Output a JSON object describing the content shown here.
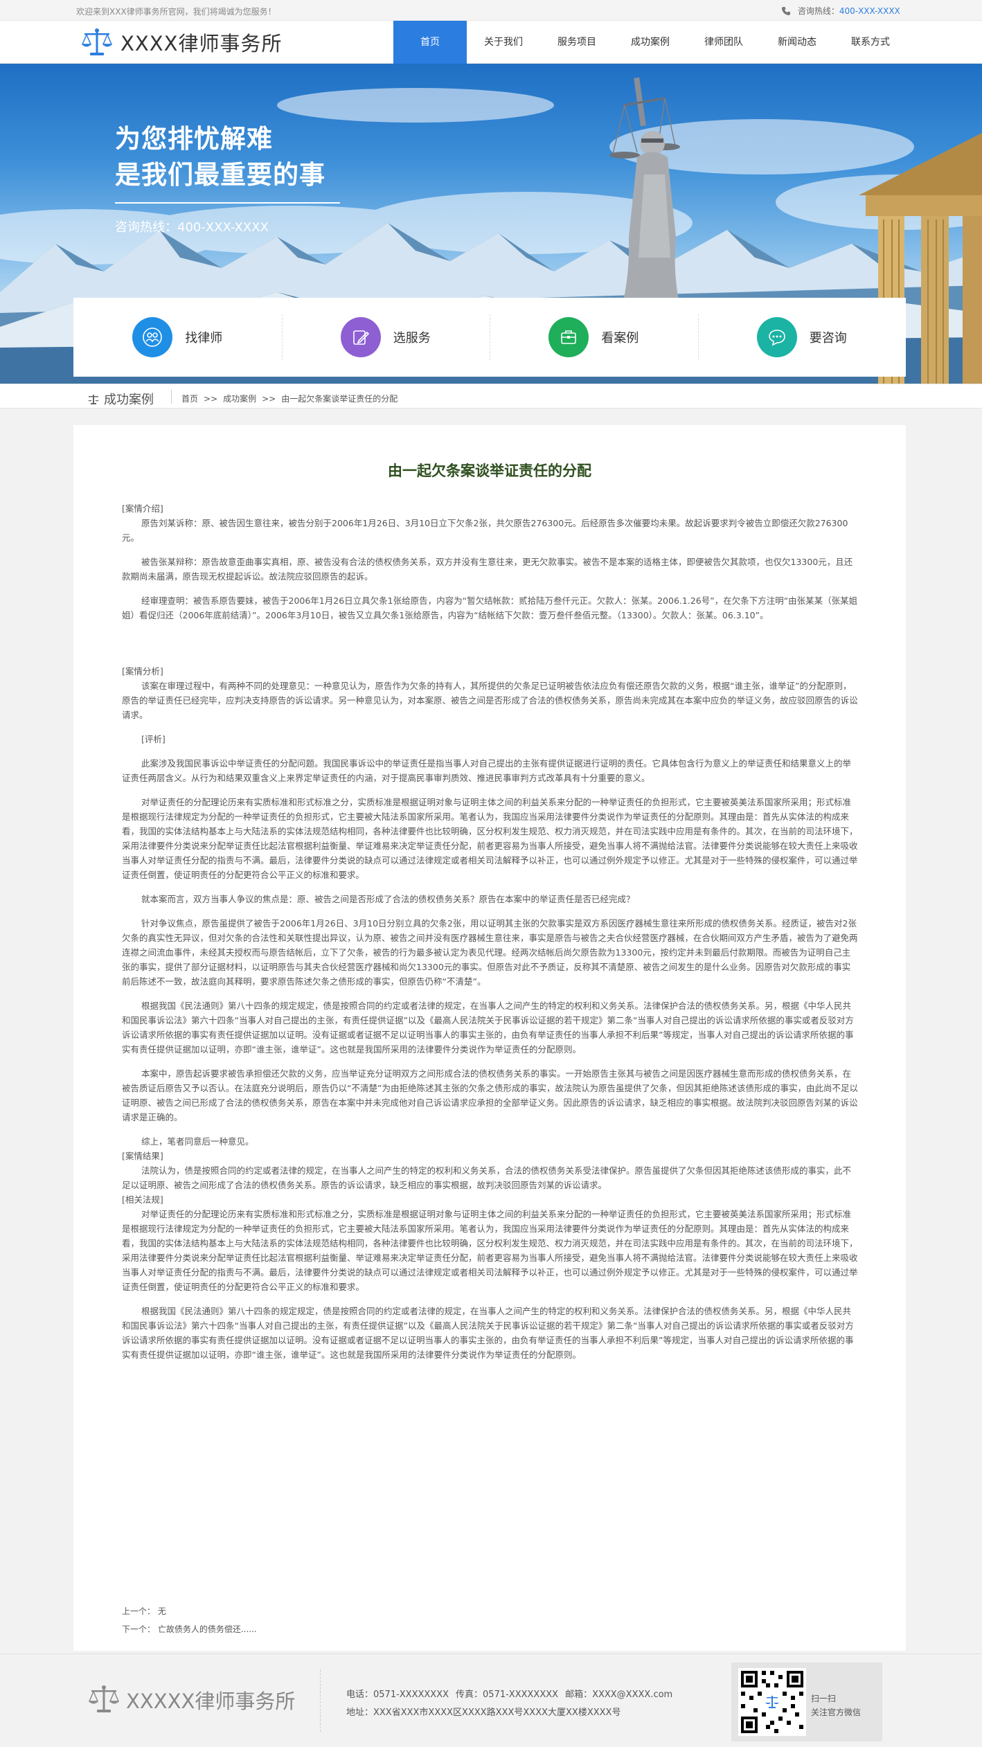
{
  "topbar": {
    "welcome": "欢迎来到XXX律师事务所官网，我们将竭诚为您服务！",
    "hotline_label": "咨询热线：",
    "hotline_number": "400-XXX-XXXX"
  },
  "header": {
    "logo_text": "XXXX律师事务所",
    "nav": [
      "首页",
      "关于我们",
      "服务项目",
      "成功案例",
      "律师团队",
      "新闻动态",
      "联系方式"
    ]
  },
  "banner": {
    "slogan_line1": "为您排忧解难",
    "slogan_line2": "是我们最重要的事",
    "hotline": "咨询热线：400-XXX-XXXX"
  },
  "services": [
    {
      "label": "找律师",
      "icon": "people-icon",
      "color": "#1f8fe6"
    },
    {
      "label": "选服务",
      "icon": "edit-icon",
      "color": "#8d5fd3"
    },
    {
      "label": "看案例",
      "icon": "briefcase-icon",
      "color": "#1fae5a"
    },
    {
      "label": "要咨询",
      "icon": "chat-icon",
      "color": "#1bb3a3"
    }
  ],
  "breadcrumb": {
    "section": "成功案例",
    "items": [
      "首页",
      ">>",
      "成功案例",
      ">>",
      "由一起欠条案谈举证责任的分配"
    ]
  },
  "article": {
    "title": "由一起欠条案谈举证责任的分配",
    "h_case": "[案情介绍]",
    "p1": "原告刘某诉称：原、被告因生意往来，被告分别于2006年1月26日、3月10日立下欠条2张，共欠原告276300元。后经原告多次催要均未果。故起诉要求判令被告立即偿还欠款276300元。",
    "p2": "被告张某辩称：原告故意歪曲事实真相，原、被告没有合法的债权债务关系，双方并没有生意往来，更无欠款事实。被告不是本案的适格主体，即便被告欠其款项，也仅欠13300元，且还款期尚未届满，原告现无权提起诉讼。故法院应驳回原告的起诉。",
    "p3": "经审理查明：被告系原告要妹，被告于2006年1月26日立具欠条1张给原告，内容为“暂欠结帐款：贰拾陆万叁仟元正。欠款人：张某。2006.1.26号”，在欠条下方注明“由张某某（张某姐姐）看促归还（2006年底前结清）”。2006年3月10日，被告又立具欠条1张给原告，内容为“结帐结下欠款：壹万叁仟叁佰元整。（13300）。欠款人：张某。06.3.10”。",
    "h_analysis": "[案情分析]",
    "p4": "该案在审理过程中，有两种不同的处理意见：一种意见认为，原告作为欠条的持有人，其所提供的欠条足已证明被告依法应负有偿还原告欠款的义务，根据“谁主张，谁举证”的分配原则，原告的举证责任已经完毕，应判决支持原告的诉讼请求。另一种意见认为，对本案原、被告之间是否形成了合法的债权债务关系，原告尚未完成其在本案中应负的举证义务，故应驳回原告的诉讼请求。",
    "h_comment": "[评析]",
    "p5": "此案涉及我国民事诉讼中举证责任的分配问题。我国民事诉讼中的举证责任是指当事人对自己提出的主张有提供证据进行证明的责任。它具体包含行为意义上的举证责任和结果意义上的举证责任两层含义。从行为和结果双重含义上来界定举证责任的内涵，对于提高民事审判质效、推进民事审判方式改革具有十分重要的意义。",
    "p6": "对举证责任的分配理论历来有实质标准和形式标准之分，实质标准是根据证明对象与证明主体之间的利益关系来分配的一种举证责任的负担形式，它主要被英美法系国家所采用；形式标准是根据现行法律规定为分配的一种举证责任的负担形式，它主要被大陆法系国家所采用。笔者认为，我国应当采用法律要件分类说作为举证责任的分配原则。其理由是：首先从实体法的构成来看，我国的实体法结构基本上与大陆法系的实体法规范结构相同，各种法律要件也比较明确，区分权利发生规范、权力消灭规范，并在司法实践中应用是有条件的。其次，在当前的司法环境下，采用法律要件分类说来分配举证责任比起法官根据利益衡量、举证难易来决定举证责任分配，前者更容易为当事人所接受，避免当事人将不满抛给法官。法律要件分类说能够在较大责任上来吸收当事人对举证责任分配的指责与不满。最后，法律要件分类说的缺点可以通过法律规定或者相关司法解释予以补正，也可以通过例外规定予以修正。尤其是对于一些特殊的侵权案件，可以通过举证责任倒置，使证明责任的分配更符合公平正义的标准和要求。",
    "p7": "就本案而言，双方当事人争议的焦点是：原、被告之间是否形成了合法的债权债务关系？原告在本案中的举证责任是否已经完成？",
    "p8": "针对争议焦点，原告虽提供了被告于2006年1月26日、3月10日分别立具的欠条2张，用以证明其主张的欠款事实是双方系因医疗器械生意往来所形成的债权债务关系。经质证，被告对2张欠条的真实性无异议，但对欠条的合法性和关联性提出异议，认为原、被告之间并没有医疗器械生意往来，事实是原告与被告之夫合伙经营医疗器械，在合伙期间双方产生矛盾，被告为了避免两连襟之间流血事件，未经其夫授权而与原告结帐后，立下了欠条，被告的行为最多被认定为表见代理。经两次结帐后尚欠原告款为13300元，按约定并未到最后付款期限。而被告为证明自己主张的事实，提供了部分证据材料，以证明原告与其夫合伙经营医疗器械和尚欠13300元的事实。但原告对此不予质证，反称其不清楚原、被告之间发生的是什么业务。因原告对欠款形成的事实前后陈述不一致，故法庭向其释明，要求原告陈述欠条之债形成的事实，但原告仍称“不清楚”。",
    "p9": "根据我国《民法通则》第八十四条的规定规定，债是按照合同的约定或者法律的规定，在当事人之间产生的特定的权利和义务关系。法律保护合法的债权债务关系。另，根据《中华人民共和国民事诉讼法》第六十四条“当事人对自己提出的主张，有责任提供证据”以及《最高人民法院关于民事诉讼证据的若干规定》第二条“当事人对自己提出的诉讼请求所依据的事实或者反驳对方诉讼请求所依据的事实有责任提供证据加以证明。没有证据或者证据不足以证明当事人的事实主张的，由负有举证责任的当事人承担不利后果”等规定，当事人对自己提出的诉讼请求所依据的事实有责任提供证据加以证明，亦即“谁主张，谁举证”。这也就是我国所采用的法律要件分类说作为举证责任的分配原则。",
    "p10": "本案中，原告起诉要求被告承担偿还欠款的义务，应当举证充分证明双方之间形成合法的债权债务关系的事实。一开始原告主张其与被告之间是因医疗器械生意而形成的债权债务关系，在被告质证后原告又予以否认。在法庭充分说明后，原告仍以“不清楚”为由拒绝陈述其主张的欠条之债形成的事实，故法院认为原告虽提供了欠条，但因其拒绝陈述该债形成的事实，由此尚不足以证明原、被告之间已形成了合法的债权债务关系，原告在本案中并未完成他对自己诉讼请求应承担的全部举证义务。因此原告的诉讼请求，缺乏相应的事实根据。故法院判决驳回原告刘某的诉讼请求是正确的。",
    "p11": "综上，笔者同意后一种意见。",
    "h_result": "[案情结果]",
    "p12": "法院认为，债是按照合同的约定或者法律的规定，在当事人之间产生的特定的权利和义务关系，合法的债权债务关系受法律保护。原告虽提供了欠条但因其拒绝陈述该债形成的事实，此不足以证明原、被告之间形成了合法的债权债务关系。原告的诉讼请求，缺乏相应的事实根据，故判决驳回原告刘某的诉讼请求。",
    "h_law": "[相关法规]",
    "p13": "对举证责任的分配理论历来有实质标准和形式标准之分，实质标准是根据证明对象与证明主体之间的利益关系来分配的一种举证责任的负担形式，它主要被英美法系国家所采用；形式标准是根据现行法律规定为分配的一种举证责任的负担形式，它主要被大陆法系国家所采用。笔者认为，我国应当采用法律要件分类说作为举证责任的分配原则。其理由是：首先从实体法的构成来看，我国的实体法结构基本上与大陆法系的实体法规范结构相同，各种法律要件也比较明确，区分权利发生规范、权力消灭规范，并在司法实践中应用是有条件的。其次，在当前的司法环境下，采用法律要件分类说来分配举证责任比起法官根据利益衡量、举证难易来决定举证责任分配，前者更容易为当事人所接受，避免当事人将不满抛给法官。法律要件分类说能够在较大责任上来吸收当事人对举证责任分配的指责与不满。最后，法律要件分类说的缺点可以通过法律规定或者相关司法解释予以补正，也可以通过例外规定予以修正。尤其是对于一些特殊的侵权案件，可以通过举证责任倒置，使证明责任的分配更符合公平正义的标准和要求。",
    "p14": "根据我国《民法通则》第八十四条的规定规定，债是按照合同的约定或者法律的规定，在当事人之间产生的特定的权利和义务关系。法律保护合法的债权债务关系。另，根据《中华人民共和国民事诉讼法》第六十四条“当事人对自己提出的主张，有责任提供证据”以及《最高人民法院关于民事诉讼证据的若干规定》第二条“当事人对自己提出的诉讼请求所依据的事实或者反驳对方诉讼请求所依据的事实有责任提供证据加以证明。没有证据或者证据不足以证明当事人的事实主张的，由负有举证责任的当事人承担不利后果”等规定，当事人对自己提出的诉讼请求所依据的事实有责任提供证据加以证明，亦即“谁主张，谁举证”。这也就是我国所采用的法律要件分类说作为举证责任的分配原则。",
    "prev": "上一个： 无",
    "next": "下一个： 亡故债务人的债务偿还......"
  },
  "footer": {
    "logo_text": "XXXXX律师事务所",
    "phone": "电话：0571-XXXXXXXX",
    "fax": "传真：0571-XXXXXXXX",
    "email": "邮箱：XXXX@XXXX.com",
    "address": "地址：XXX省XXX市XXXX区XXXX路XXX号XXXX大厦XX楼XXXX号",
    "qr_line1": "扫一扫",
    "qr_line2": "关注官方微信"
  }
}
